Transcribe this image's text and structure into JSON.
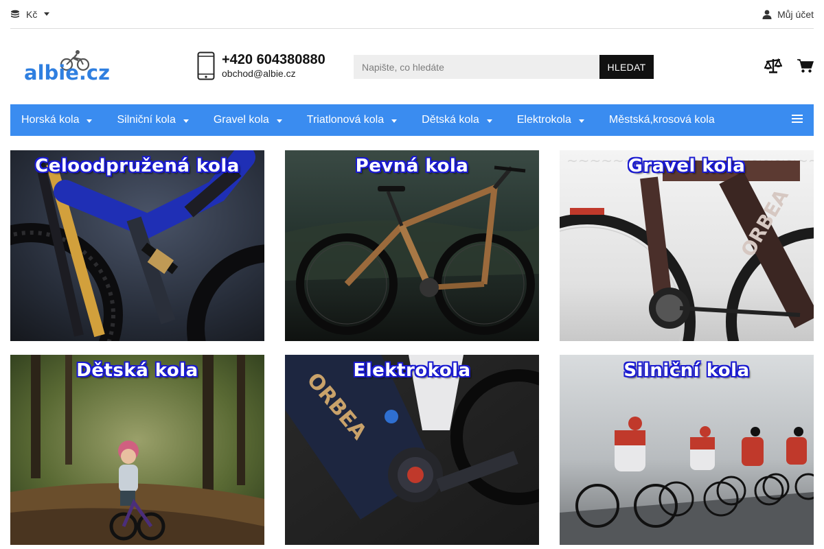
{
  "topbar": {
    "currency_label": "Kč",
    "account_label": "Můj účet",
    "currency_icon": "coins-icon",
    "account_icon": "user-icon"
  },
  "header": {
    "logo_text": "albie.cz",
    "phone": "+420 604380880",
    "email": "obchod@albie.cz",
    "search_placeholder": "Napište, co hledáte",
    "search_button": "HLEDAT",
    "compare_icon": "scale-icon",
    "cart_icon": "cart-icon"
  },
  "nav": {
    "items": [
      {
        "label": "Horská kola",
        "dropdown": true
      },
      {
        "label": "Silniční kola",
        "dropdown": true
      },
      {
        "label": "Gravel kola",
        "dropdown": true
      },
      {
        "label": "Triatlonová kola",
        "dropdown": true
      },
      {
        "label": "Dětská kola",
        "dropdown": true
      },
      {
        "label": "Elektrokola",
        "dropdown": true
      },
      {
        "label": "Městská,krosová kola",
        "dropdown": false
      }
    ],
    "menu_icon": "hamburger-icon"
  },
  "categories": [
    {
      "title": "Celoodpružená kola"
    },
    {
      "title": "Pevná kola"
    },
    {
      "title": "Gravel kola"
    },
    {
      "title": "Dětská kola"
    },
    {
      "title": "Elektrokola"
    },
    {
      "title": "Silniční kola"
    }
  ],
  "colors": {
    "nav_bg": "#3a8cf0",
    "brand_blue": "#2f7fe0",
    "button_bg": "#111111"
  }
}
